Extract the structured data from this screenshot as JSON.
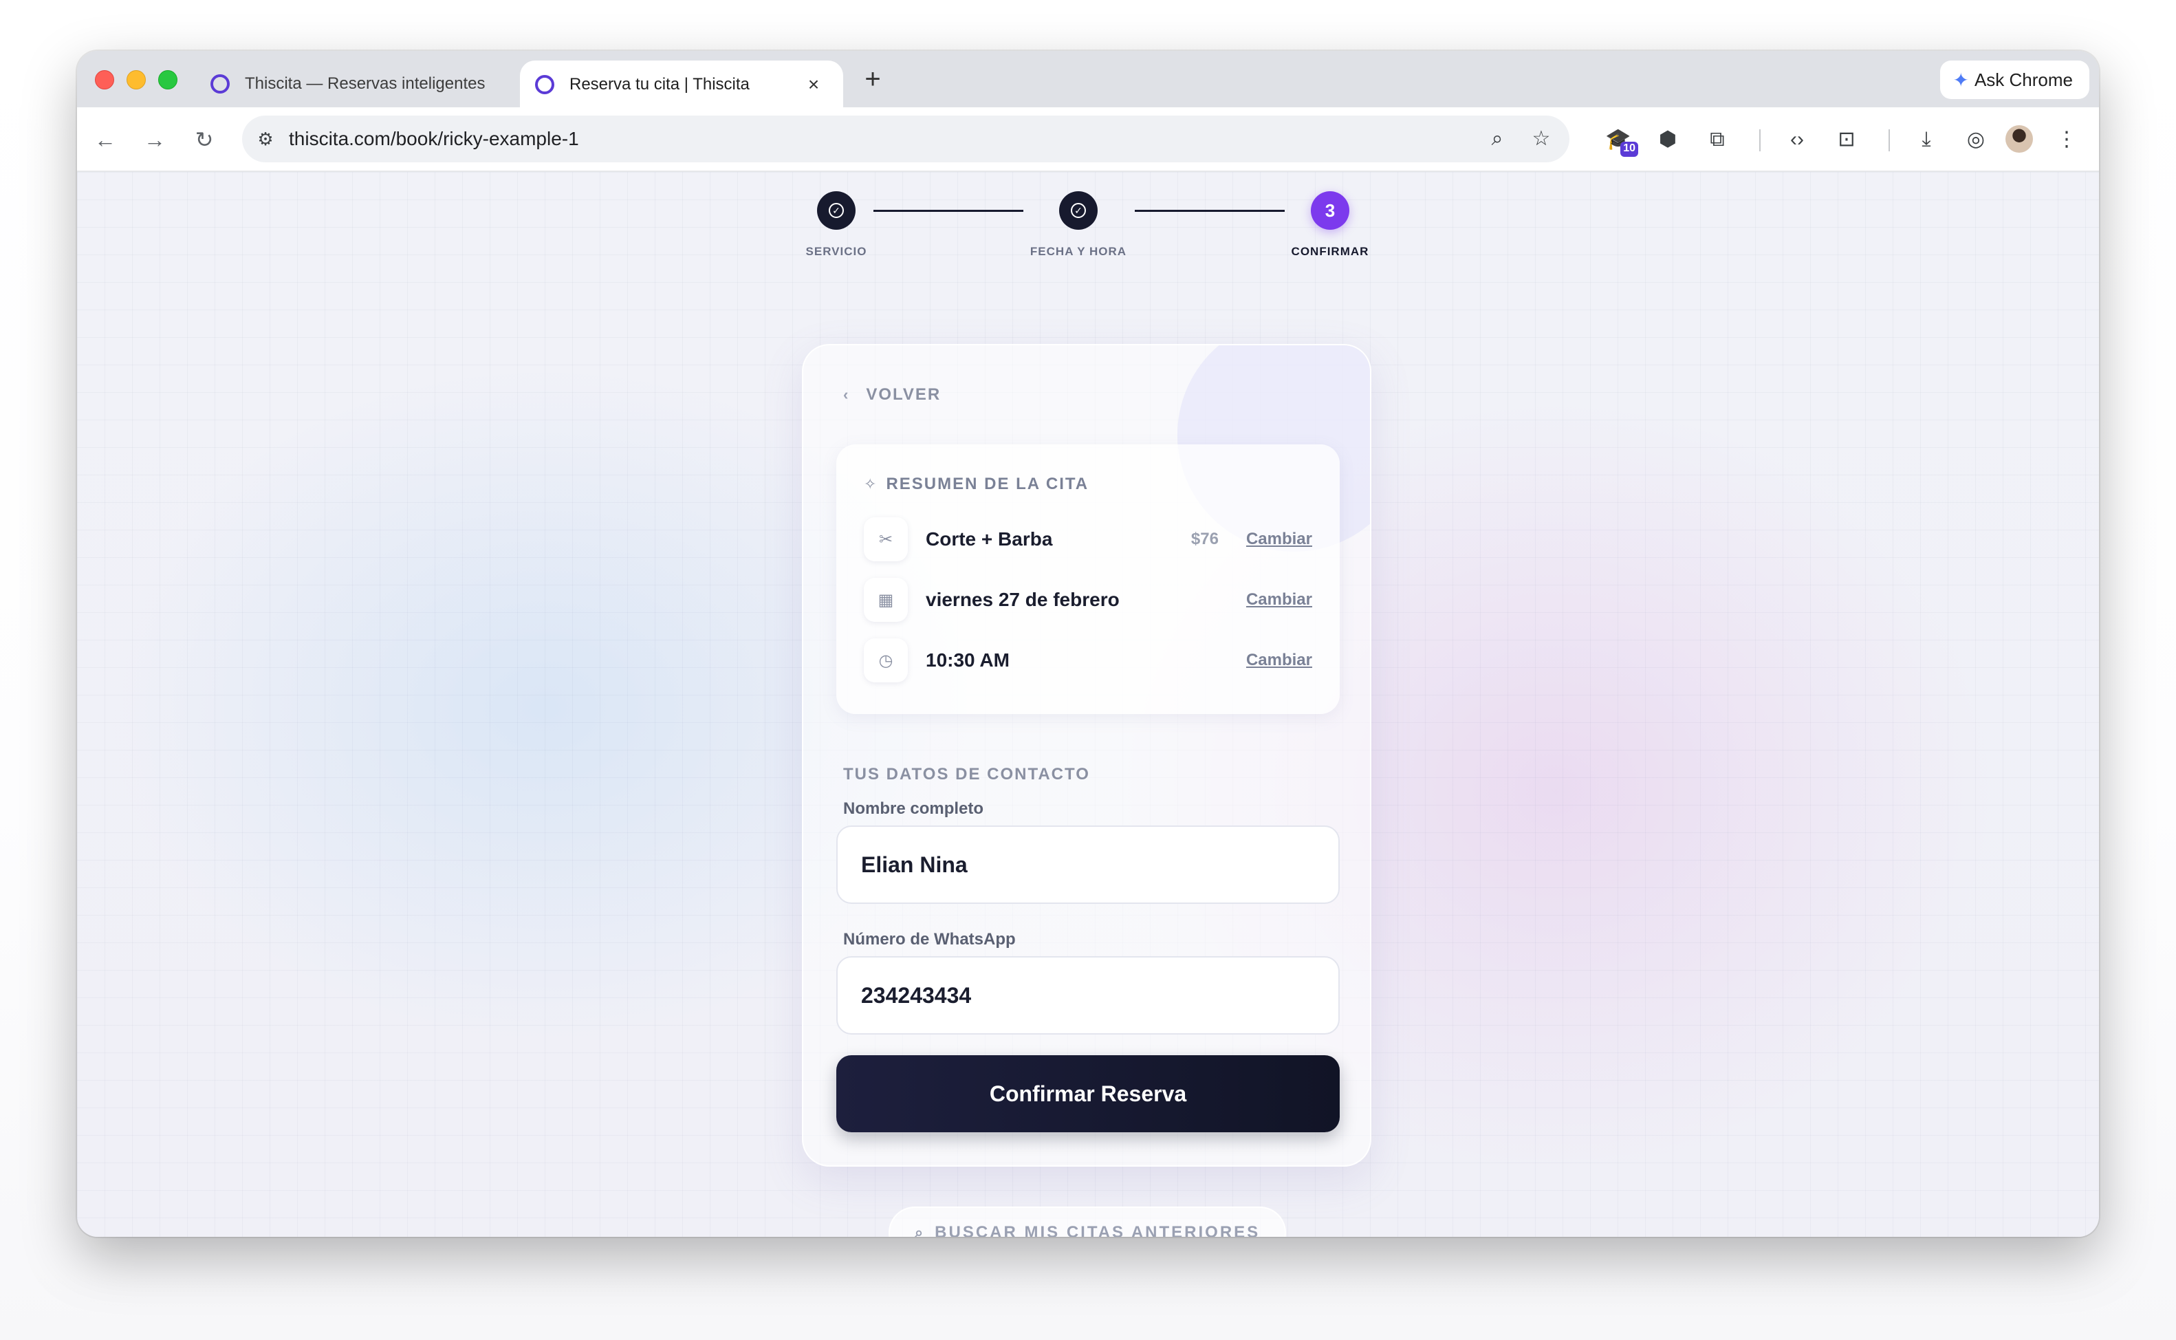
{
  "browser": {
    "tabs": [
      {
        "title": "Thiscita — Reservas inteligentes",
        "active": false
      },
      {
        "title": "Reserva tu cita | Thiscita",
        "active": true
      }
    ],
    "new_tab_label": "+",
    "ask_chrome": "Ask Chrome",
    "url": "thiscita.com/book/ricky-example-1",
    "extension_badge": "10"
  },
  "stepper": {
    "steps": [
      {
        "label": "SERVICIO",
        "state": "done"
      },
      {
        "label": "FECHA Y HORA",
        "state": "done"
      },
      {
        "label": "CONFIRMAR",
        "state": "active",
        "number": "3"
      }
    ]
  },
  "card": {
    "back_label": "VOLVER",
    "summary_title": "RESUMEN DE LA CITA",
    "summary_rows": [
      {
        "icon": "scissors-icon",
        "text": "Corte + Barba",
        "price": "$76",
        "change": "Cambiar"
      },
      {
        "icon": "calendar-icon",
        "text": "viernes 27 de febrero",
        "price": "",
        "change": "Cambiar"
      },
      {
        "icon": "clock-icon",
        "text": "10:30 AM",
        "price": "",
        "change": "Cambiar"
      }
    ],
    "contact_title": "TUS DATOS DE CONTACTO",
    "name_label": "Nombre completo",
    "name_value": "Elian Nina",
    "phone_label": "Número de WhatsApp",
    "phone_value": "234243434",
    "confirm_label": "Confirmar Reserva"
  },
  "search_previous_label": "BUSCAR MIS CITAS ANTERIORES",
  "colors": {
    "accent": "#7c3aed",
    "dark": "#171a2e",
    "muted": "#8a90a2"
  }
}
